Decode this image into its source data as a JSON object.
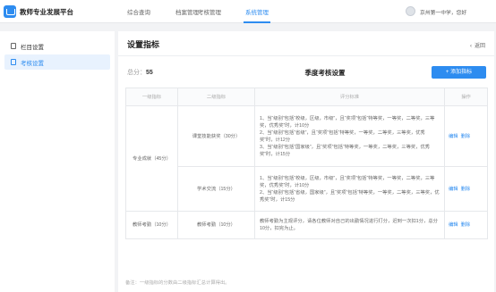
{
  "app": {
    "title": "教师专业发展平台"
  },
  "nav": [
    {
      "label": "综合查询"
    },
    {
      "label": "档案管理"
    },
    {
      "label": "考核管理"
    },
    {
      "label": "系统管理"
    }
  ],
  "user": {
    "greeting": "京州第一中学，您好"
  },
  "sidebar": {
    "items": [
      {
        "label": "栏目设置"
      },
      {
        "label": "考核设置"
      }
    ]
  },
  "page": {
    "title": "设置指标",
    "back_label": "返回"
  },
  "summary": {
    "total_label": "总分：",
    "total_value": "55",
    "table_title": "季度考核设置",
    "add_button": "+ 添加指标"
  },
  "table": {
    "headers": [
      "一级指标",
      "二级指标",
      "评分标准",
      "操作"
    ],
    "groups": [
      {
        "level1": "专业成就（45分）",
        "rows": [
          {
            "level2": "课堂技能获奖（30分）",
            "criteria": [
              "1、当“级别”包括“校级，区级，市级”，且“奖项”包括“特等奖，一等奖，二等奖，三等奖，优秀奖”时，计10分",
              "2、当“级别”包括“省级”，且“奖项”包括“特等奖，一等奖，二等奖，三等奖，优秀奖”时，计12分",
              "3、当“级别”包括“国家级”，且“奖项”包括“特等奖，一等奖，二等奖，三等奖，优秀奖”时，计15分"
            ]
          },
          {
            "level2": "学术交流（15分）",
            "criteria": [
              "1、当“级别”包括“校级，区级，市级”，且“奖项”包括“特等奖，一等奖，二等奖，三等奖，优秀奖”时，计10分",
              "2、当“级别”包括“省级，国家级”，且“奖项”包括“特等奖，一等奖，二等奖，三等奖，优秀奖”时，计15分"
            ]
          }
        ]
      },
      {
        "level1": "教师考勤（10分）",
        "rows": [
          {
            "level2": "教师考勤（10分）",
            "criteria": [
              "教师考勤为主观评分，请各位教师对自己的出勤情况进行打分，迟到一次扣1分，总分10分，扣完为止。"
            ]
          }
        ]
      }
    ],
    "op_edit": "编辑",
    "op_delete": "删除"
  },
  "footer": {
    "note": "备注：一级指标的分数由二级指标汇总计算得出。"
  },
  "colors": {
    "accent": "#2d8cf0",
    "sidebar_active_bg": "#e8f2fe"
  },
  "icons": {
    "logo": "app-logo-icon",
    "avatar": "user-avatar",
    "sidebar": [
      "column-icon",
      "assessment-icon"
    ],
    "back": "chevron-left-icon"
  }
}
